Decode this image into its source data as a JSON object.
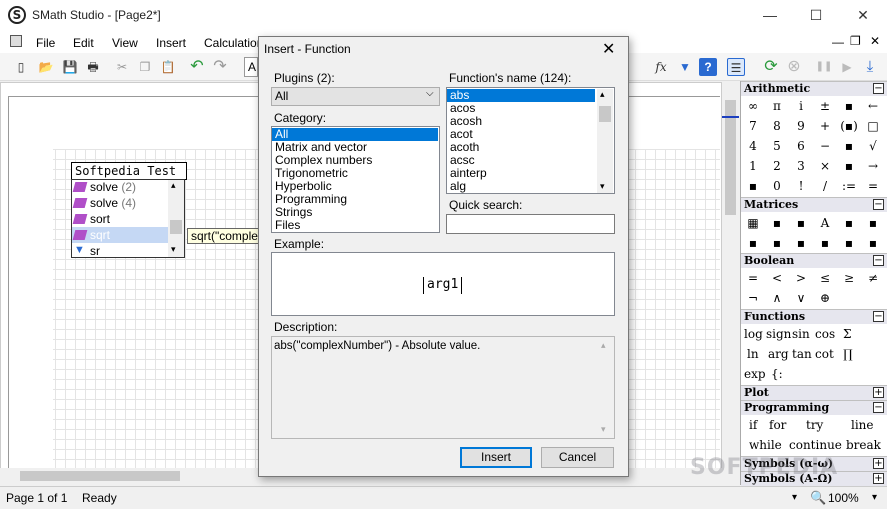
{
  "window": {
    "title": "SMath Studio - [Page2*]",
    "app_icon_glyph": "S",
    "minimize_glyph": "—",
    "maximize_glyph": "☐",
    "close_glyph": "✕",
    "doc_min_glyph": "—",
    "doc_restore_glyph": "❐",
    "doc_close_glyph": "✕"
  },
  "menu": [
    "File",
    "Edit",
    "View",
    "Insert",
    "Calculation"
  ],
  "toolbar": {
    "new_glyph": "▯",
    "open_glyph": "📂",
    "save_glyph": "💾",
    "print_glyph": "🖶",
    "cut_glyph": "✂",
    "copy_glyph": "❐",
    "paste_glyph": "📋",
    "undo_glyph": "↶",
    "redo_glyph": "↷",
    "font_box": "A",
    "function_glyph": "fx",
    "filter_glyph": "▼",
    "help_glyph": "?",
    "panel_glyph": "☰",
    "recalc_glyph": "⟳",
    "stop_glyph": "⊗",
    "pause_glyph": "❚❚",
    "play_glyph": "▶",
    "step_glyph": "⤓"
  },
  "canvas": {
    "editor_text": "Softpedia Test",
    "autocomplete": [
      {
        "name": "solve",
        "arity": "(2)"
      },
      {
        "name": "solve",
        "arity": "(4)"
      },
      {
        "name": "sort",
        "arity": ""
      },
      {
        "name": "sqrt",
        "arity": ""
      },
      {
        "name": "sr",
        "arity": ""
      }
    ],
    "tooltip": "sqrt(\"complex"
  },
  "status": {
    "page": "Page 1 of 1",
    "state": "Ready",
    "zoom": "100%",
    "zoom_arrow": "▾",
    "zoom_glyph": "🔍"
  },
  "panel": {
    "arithmetic": {
      "title": "Arithmetic",
      "rows": [
        [
          "∞",
          "π",
          "i",
          "±",
          "▪",
          "←"
        ],
        [
          "7",
          "8",
          "9",
          "+",
          "(▪)",
          "□"
        ],
        [
          "4",
          "5",
          "6",
          "−",
          "▪",
          "√"
        ],
        [
          "1",
          "2",
          "3",
          "×",
          "▪",
          "→"
        ],
        [
          "▪",
          "0",
          "!",
          "/",
          ":=",
          "="
        ]
      ]
    },
    "matrices": {
      "title": "Matrices",
      "rows": [
        [
          "▦",
          "▪",
          "▪",
          "A",
          "▪",
          "▪"
        ],
        [
          "▪",
          "▪",
          "▪",
          "▪",
          "▪",
          "▪"
        ]
      ]
    },
    "boolean": {
      "title": "Boolean",
      "rows": [
        [
          "=",
          "<",
          ">",
          "≤",
          "≥",
          "≠"
        ],
        [
          "¬",
          "∧",
          "∨",
          "⊕"
        ]
      ]
    },
    "functions": {
      "title": "Functions",
      "rows": [
        [
          "log",
          "sign",
          "sin",
          "cos",
          "Σ"
        ],
        [
          "ln",
          "arg",
          "tan",
          "cot",
          "∏"
        ],
        [
          "exp",
          "{:"
        ]
      ]
    },
    "plot": {
      "title": "Plot"
    },
    "programming": {
      "title": "Programming",
      "rows": [
        [
          "if",
          "for",
          "try",
          "line"
        ],
        [
          "while",
          "continue",
          "break"
        ]
      ]
    },
    "symbols_lower": {
      "title": "Symbols (α-ω)"
    },
    "symbols_upper": {
      "title": "Symbols (Α-Ω)"
    },
    "collapse_glyph": "−",
    "expand_glyph": "+"
  },
  "dialog": {
    "title": "Insert - Function",
    "close_glyph": "✕",
    "plugins_label": "Plugins (2):",
    "plugins_value": "All",
    "select_arrow": "⌵",
    "category_label": "Category:",
    "categories": [
      "All",
      "Matrix and vector",
      "Complex numbers",
      "Trigonometric",
      "Hyperbolic",
      "Programming",
      "Strings",
      "Files"
    ],
    "functions_label": "Function's name (124):",
    "functions": [
      "abs",
      "acos",
      "acosh",
      "acot",
      "acoth",
      "acsc",
      "ainterp",
      "alg"
    ],
    "quick_search_label": "Quick search:",
    "quick_search_value": "",
    "example_label": "Example:",
    "example": "arg1",
    "description_label": "Description:",
    "description": "abs(\"complexNumber\") - Absolute value.",
    "scroll_up": "▴",
    "scroll_down": "▾",
    "insert_label": "Insert",
    "cancel_label": "Cancel"
  },
  "watermark": "SOFTPEDIA"
}
